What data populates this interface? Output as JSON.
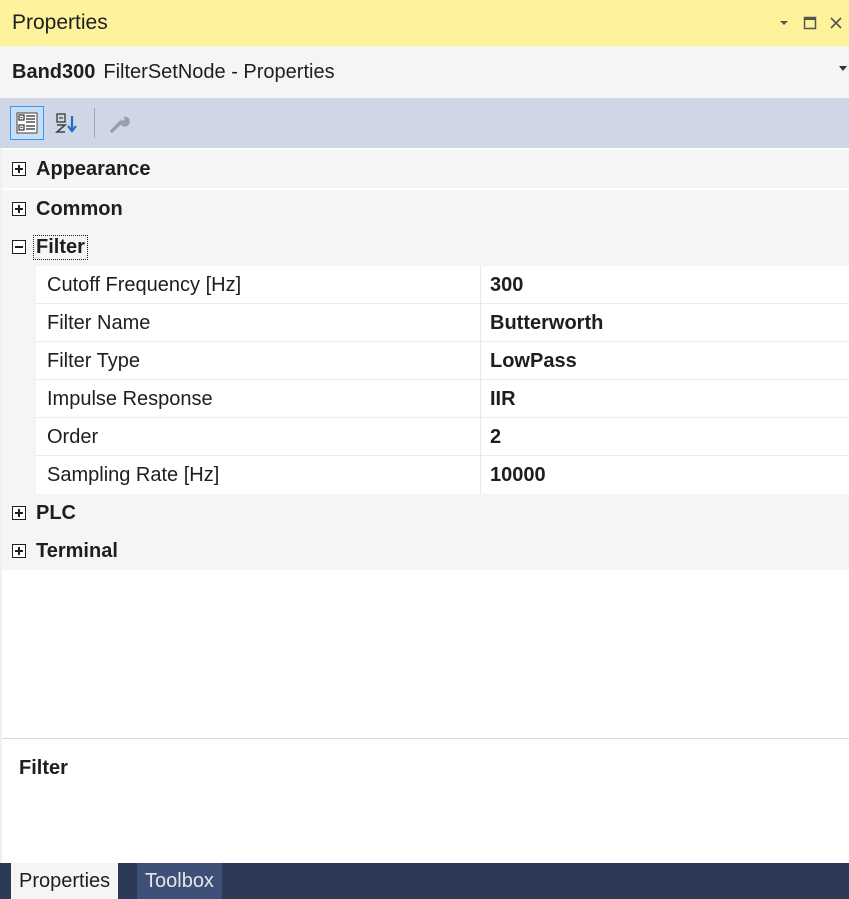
{
  "window": {
    "title": "Properties",
    "controls": [
      "dropdown-icon",
      "maximize-icon",
      "close-icon"
    ]
  },
  "object": {
    "name": "Band300",
    "type": "FilterSetNode - Properties"
  },
  "toolbar": {
    "buttons": [
      "categorized-icon",
      "alphabetical-icon",
      "property-pages-icon"
    ]
  },
  "categories": {
    "appearance": {
      "label": "Appearance",
      "expanded": false
    },
    "common": {
      "label": "Common",
      "expanded": false
    },
    "filter": {
      "label": "Filter",
      "expanded": true
    },
    "plc": {
      "label": "PLC",
      "expanded": false
    },
    "terminal": {
      "label": "Terminal",
      "expanded": false
    }
  },
  "filter_properties": [
    {
      "name": "Cutoff Frequency [Hz]",
      "value": "300"
    },
    {
      "name": "Filter Name",
      "value": "Butterworth"
    },
    {
      "name": "Filter Type",
      "value": "LowPass"
    },
    {
      "name": "Impulse Response",
      "value": "IIR"
    },
    {
      "name": "Order",
      "value": "2"
    },
    {
      "name": "Sampling Rate [Hz]",
      "value": "10000"
    }
  ],
  "description": {
    "title": "Filter"
  },
  "tabs": [
    {
      "label": "Properties",
      "active": true
    },
    {
      "label": "Toolbox",
      "active": false
    }
  ],
  "colors": {
    "title_bar": "#fff29d",
    "toolbar": "#cfd6e5",
    "tab_bar": "#2d3a55",
    "inactive_tab": "#3e5077"
  }
}
